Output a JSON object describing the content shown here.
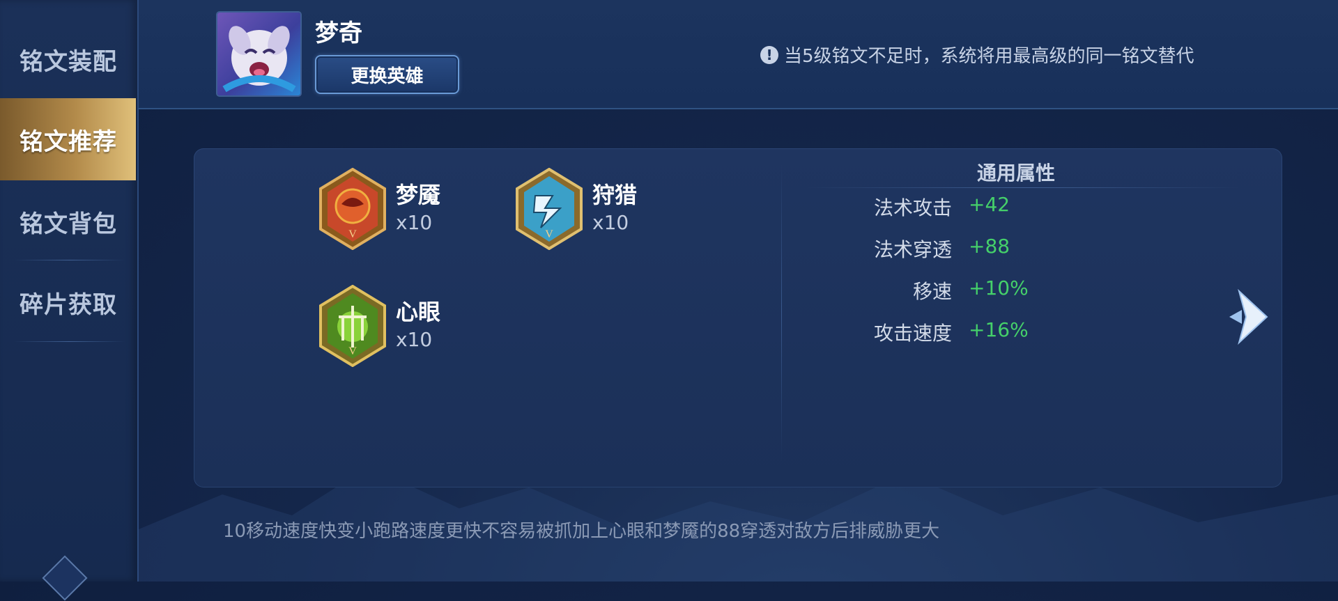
{
  "sidebar": {
    "items": [
      {
        "label": "铭文装配",
        "active": false
      },
      {
        "label": "铭文推荐",
        "active": true
      },
      {
        "label": "铭文背包",
        "active": false
      },
      {
        "label": "碎片获取",
        "active": false
      }
    ]
  },
  "header": {
    "hero_name": "梦奇",
    "change_hero_label": "更换英雄",
    "notice_icon": "!",
    "notice": "当5级铭文不足时，系统将用最高级的同一铭文替代"
  },
  "runes": [
    {
      "name": "梦魇",
      "count": "x10",
      "color": "#c8482a",
      "icon": "nightmare-rune-icon"
    },
    {
      "name": "狩猎",
      "count": "x10",
      "color": "#3ba0c8",
      "icon": "hunt-rune-icon"
    },
    {
      "name": "心眼",
      "count": "x10",
      "color": "#6aa72c",
      "icon": "mind-eye-rune-icon"
    }
  ],
  "stats": {
    "title": "通用属性",
    "rows": [
      {
        "label": "法术攻击",
        "value": "+42"
      },
      {
        "label": "法术穿透",
        "value": "+88"
      },
      {
        "label": "移速",
        "value": "+10%"
      },
      {
        "label": "攻击速度",
        "value": "+16%"
      }
    ]
  },
  "footer": {
    "description": "10移动速度快变小跑路速度更快不容易被抓加上心眼和梦魇的88穿透对敌方后排威胁更大"
  },
  "colors": {
    "accent_gold": "#b28a4a",
    "stat_green": "#45d06a",
    "bg_navy": "#14264a"
  }
}
